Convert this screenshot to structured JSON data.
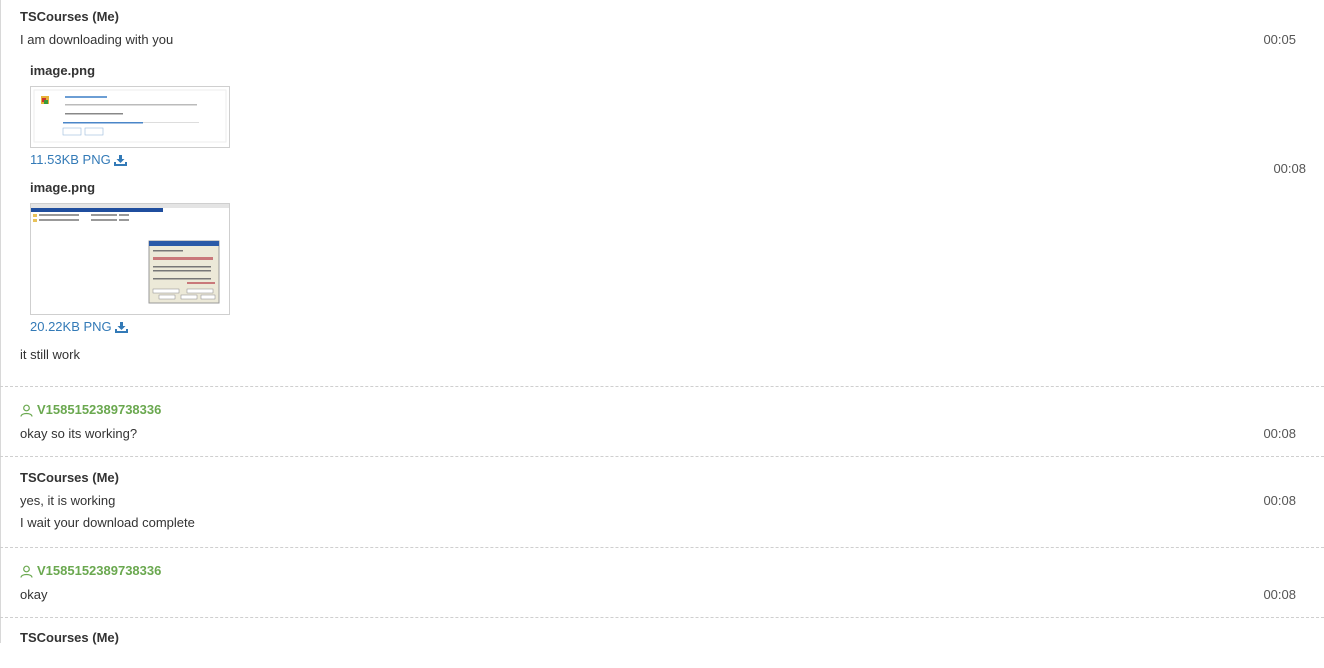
{
  "messages": [
    {
      "sender": "TSCourses (Me)",
      "lines": [
        {
          "text": "I am downloading with you",
          "time": "00:05"
        }
      ],
      "attachments": [
        {
          "name": "image.png",
          "meta": "11.53KB PNG",
          "time": ""
        },
        {
          "name": "image.png",
          "meta": "20.22KB PNG",
          "time": "00:08"
        }
      ],
      "after": "it still work"
    },
    {
      "sender": "V1585152389738336",
      "lines": [
        {
          "text": "okay so its working?",
          "time": "00:08"
        }
      ]
    },
    {
      "sender": "TSCourses (Me)",
      "lines": [
        {
          "text": "yes, it is working",
          "time": "00:08"
        },
        {
          "text": "I wait your download complete",
          "time": ""
        }
      ]
    },
    {
      "sender": "V1585152389738336",
      "lines": [
        {
          "text": "okay",
          "time": "00:08"
        }
      ]
    },
    {
      "sender": "TSCourses (Me)",
      "lines": []
    }
  ],
  "colors": {
    "visitor": "#6aa84f",
    "link": "#337ab7",
    "divider": "#cfcfcf"
  },
  "icons": {
    "download": "download-icon",
    "user": "user-icon"
  }
}
